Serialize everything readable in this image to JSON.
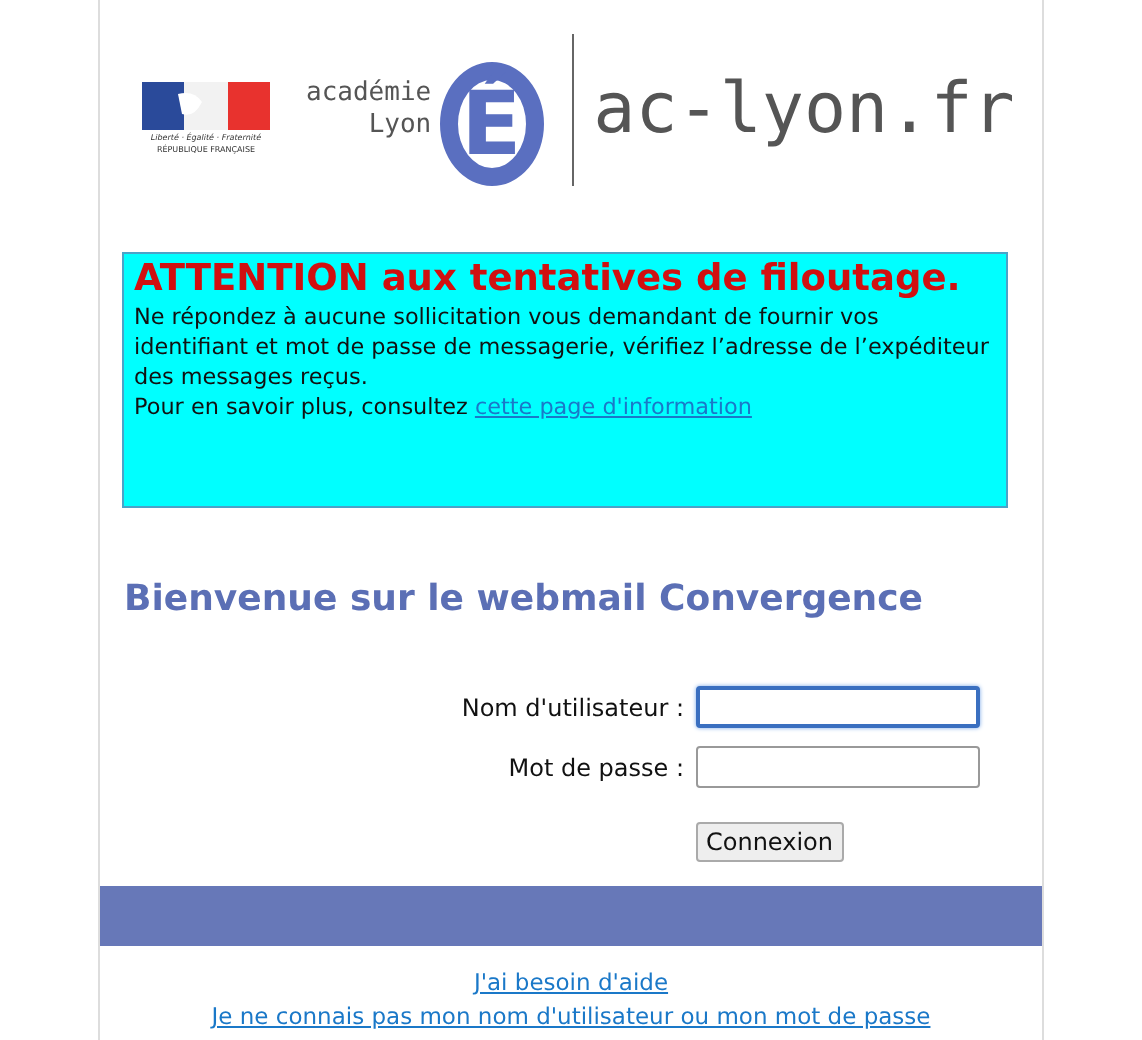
{
  "header": {
    "republic_motto": "Liberté · Égalité · Fraternité",
    "republic_name": "RÉPUBLIQUE FRANÇAISE",
    "academie_top": "académie",
    "academie_bottom": "Lyon",
    "emblem_letter": "É",
    "site": "ac-lyon.fr"
  },
  "warning": {
    "title": "ATTENTION aux tentatives de filoutage.",
    "text": "Ne répondez à aucune sollicitation vous demandant de fournir vos identifiant et mot de passe de messagerie, vérifiez l’adresse de l’expéditeur des messages reçus.",
    "more": "Pour en savoir plus, consultez",
    "link": "cette page d'information"
  },
  "heading": "Bienvenue sur le webmail Convergence",
  "fields": [
    {
      "label": "Nom d'utilisateur :",
      "focused": true
    },
    {
      "label": "Mot de passe :",
      "focused": false
    }
  ],
  "submit": "Connexion",
  "links": [
    "J'ai besoin d'aide",
    "Je ne connais pas mon nom d'utilisateur ou mon mot de passe"
  ]
}
